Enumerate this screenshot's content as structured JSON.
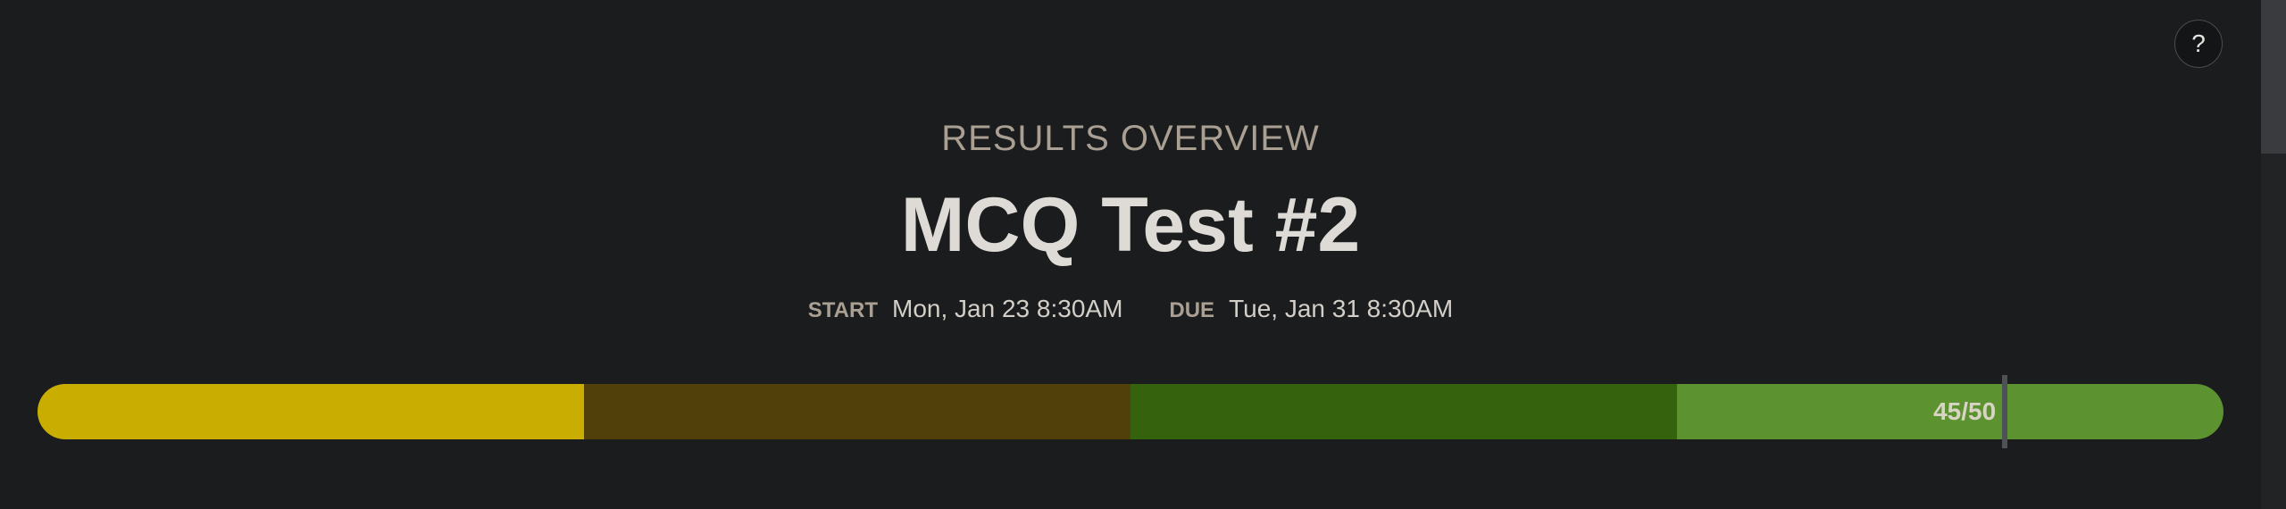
{
  "help_button": {
    "label": "?",
    "icon": "question-icon"
  },
  "header": {
    "overline": "RESULTS OVERVIEW",
    "title": "MCQ Test #2"
  },
  "dates": {
    "start_label": "START",
    "start_value": "Mon, Jan 23 8:30AM",
    "due_label": "DUE",
    "due_value": "Tue, Jan 31 8:30AM"
  },
  "progress": {
    "score_label": "45/50",
    "score": 45,
    "max": 50,
    "segments": [
      {
        "fraction": 0.25,
        "color": "#c9ad00"
      },
      {
        "fraction": 0.25,
        "color": "#52400a"
      },
      {
        "fraction": 0.25,
        "color": "#34620d"
      },
      {
        "fraction": 0.25,
        "color": "#5d9231"
      }
    ],
    "marker_color": "#4e5155"
  },
  "colors": {
    "background": "#1b1c1e",
    "muted_text": "#a99f92",
    "title_text": "#dedbd6"
  }
}
